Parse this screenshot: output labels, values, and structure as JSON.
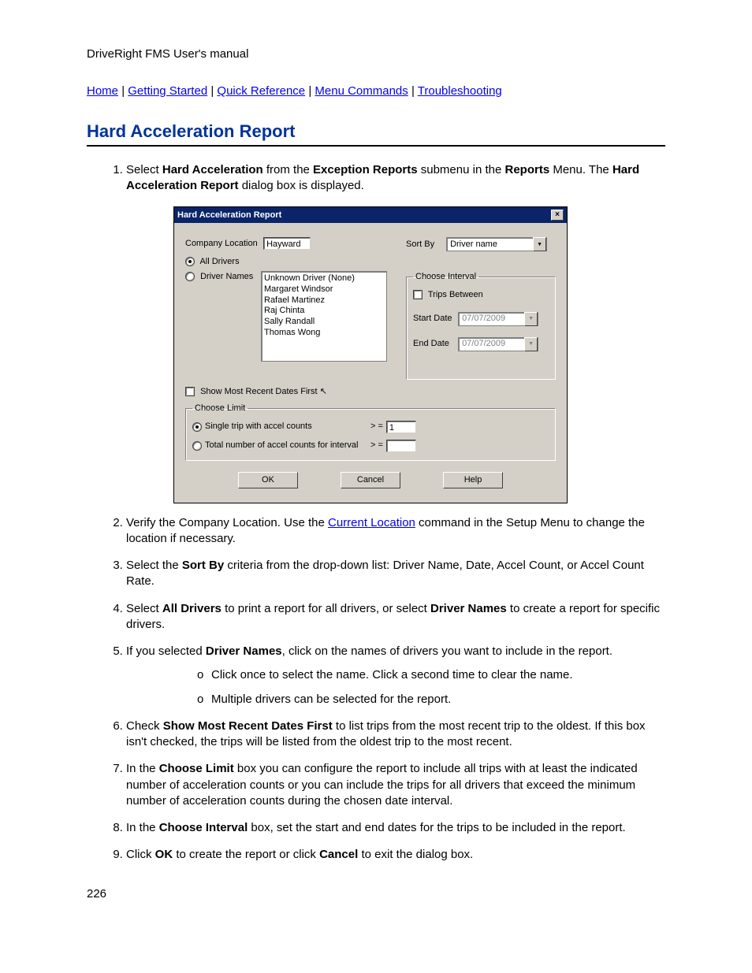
{
  "header": "DriveRight FMS User's manual",
  "nav": {
    "home": "Home",
    "getting_started": "Getting Started",
    "quick_ref": "Quick Reference",
    "menu_cmds": "Menu Commands",
    "troubleshoot": "Troubleshooting"
  },
  "title": "Hard Acceleration Report",
  "dialog": {
    "title": "Hard Acceleration Report",
    "company_location_label": "Company Location",
    "company_location_value": "Hayward",
    "sort_by_label": "Sort By",
    "sort_by_value": "Driver name",
    "all_drivers": "All Drivers",
    "driver_names_label": "Driver Names",
    "drivers": [
      "Unknown Driver (None)",
      "Margaret Windsor",
      "Rafael Martinez",
      "Raj Chinta",
      "Sally Randall",
      "Thomas Wong"
    ],
    "choose_interval": "Choose Interval",
    "trips_between": "Trips Between",
    "start_date_label": "Start Date",
    "start_date_value": "07/07/2009",
    "end_date_label": "End Date",
    "end_date_value": "07/07/2009",
    "show_recent": "Show Most Recent Dates First",
    "choose_limit": "Choose Limit",
    "limit_single": "Single trip with accel counts",
    "limit_total": "Total number of accel counts for interval",
    "gte": "> =",
    "single_value": "1",
    "ok": "OK",
    "cancel": "Cancel",
    "help": "Help"
  },
  "steps": {
    "s1a": "Select ",
    "s1b": "Hard Acceleration",
    "s1c": " from the ",
    "s1d": "Exception Reports",
    "s1e": " submenu in the ",
    "s1f": "Reports",
    "s1g": " Menu. The ",
    "s1h": "Hard Acceleration Report",
    "s1i": " dialog box is displayed.",
    "s2a": "Verify the Company Location. Use the ",
    "s2link": "Current Location",
    "s2b": " command in the Setup Menu to change the location if necessary.",
    "s3a": "Select the ",
    "s3b": "Sort By",
    "s3c": " criteria from the drop-down list: Driver Name, Date, Accel Count, or Accel Count Rate.",
    "s4a": "Select ",
    "s4b": "All Drivers",
    "s4c": " to print a report for all drivers, or select ",
    "s4d": "Driver Names",
    "s4e": " to create a report for specific drivers.",
    "s5a": "If you selected ",
    "s5b": "Driver Names",
    "s5c": ", click on the names of drivers you want to include in the report.",
    "s5sub1": "Click once to select the name. Click a second time to clear the name.",
    "s5sub2": "Multiple drivers can be selected for the report.",
    "s6a": "Check ",
    "s6b": "Show Most Recent Dates First",
    "s6c": " to list trips from the most recent trip to the oldest. If this box isn't checked, the trips will be listed from the oldest trip to the most recent.",
    "s7a": "In the ",
    "s7b": "Choose Limit",
    "s7c": " box you can configure the report to include all trips with at least the indicated number of acceleration counts or you can include the trips for all drivers that exceed the minimum number of acceleration counts during the chosen date interval.",
    "s8a": "In the ",
    "s8b": "Choose Interval",
    "s8c": " box, set the start and end dates for the trips to be included in the report.",
    "s9a": "Click ",
    "s9b": "OK",
    "s9c": " to create the report or click ",
    "s9d": "Cancel",
    "s9e": " to exit the dialog box."
  },
  "page_number": "226"
}
